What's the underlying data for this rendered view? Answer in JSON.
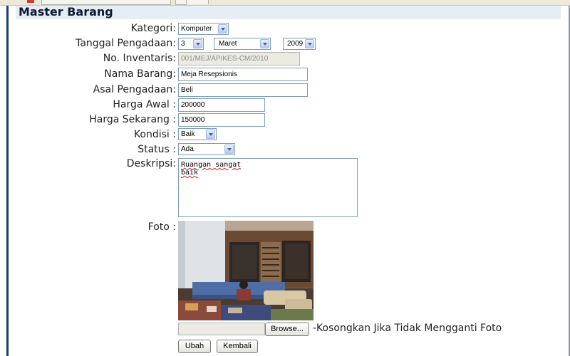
{
  "page": {
    "title": "Master Barang"
  },
  "form": {
    "kategori": {
      "label": "Kategori:",
      "value": "Komputer"
    },
    "tanggal": {
      "label": "Tanggal Pengadaan:",
      "day": "3",
      "month": "Maret",
      "year": "2009"
    },
    "inventaris": {
      "label": "No. Inventaris:",
      "value": "001/MEJ/APIKES-CM/2010"
    },
    "nama": {
      "label": "Nama Barang:",
      "value": "Meja Resepsionis"
    },
    "asal": {
      "label": "Asal Pengadaan:",
      "value": "Beli"
    },
    "harga_awal": {
      "label": "Harga Awal :",
      "value": "200000"
    },
    "harga_sekarang": {
      "label": "Harga Sekarang :",
      "value": "150000"
    },
    "kondisi": {
      "label": "Kondisi :",
      "value": "Baik"
    },
    "status": {
      "label": "Status :",
      "value": "Ada"
    },
    "deskripsi": {
      "label": "Deskripsi:",
      "line1": "Ruangan sangat",
      "line2": "baik"
    },
    "foto": {
      "label": "Foto :",
      "browse_label": "Browse...",
      "hint": "-Kosongkan Jika Tidak Mengganti Foto"
    }
  },
  "actions": {
    "ubah": "Ubah",
    "kembali": "Kembali"
  }
}
